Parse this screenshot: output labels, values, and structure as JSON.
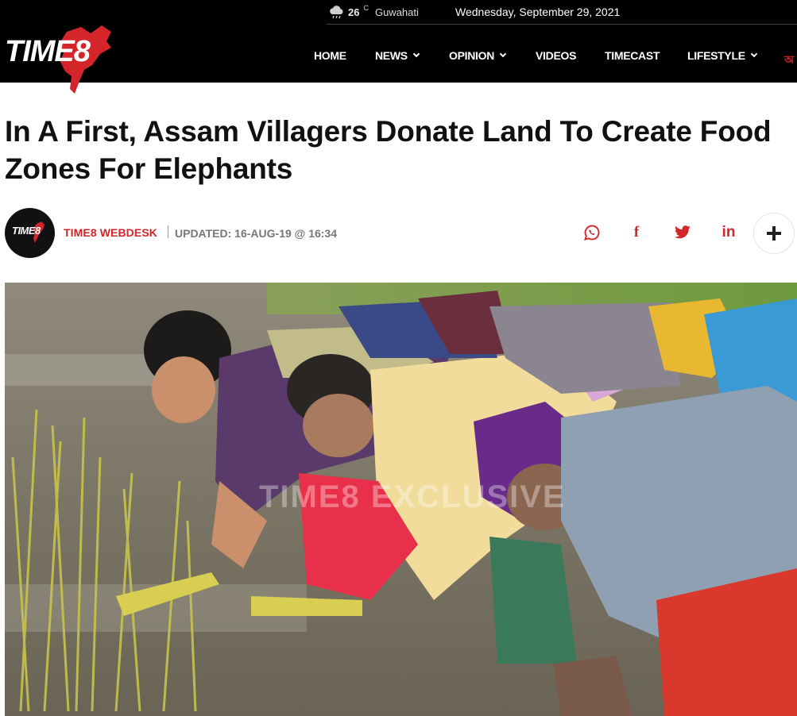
{
  "topbar": {
    "weather_temp": "26",
    "weather_unit": "C",
    "weather_city": "Guwahati",
    "weather_icon": "cloud-rain-icon",
    "date": "Wednesday, September 29, 2021"
  },
  "logo": {
    "text": "TIME8"
  },
  "nav": {
    "items": [
      {
        "label": "HOME",
        "dropdown": false
      },
      {
        "label": "NEWS",
        "dropdown": true
      },
      {
        "label": "OPINION",
        "dropdown": true
      },
      {
        "label": "VIDEOS",
        "dropdown": false
      },
      {
        "label": "TIMECAST",
        "dropdown": false
      },
      {
        "label": "LIFESTYLE",
        "dropdown": true
      }
    ],
    "edge_glyph": "অ"
  },
  "article": {
    "title": "In A First, Assam Villagers Donate Land To Create Food Zones For Elephants",
    "author": "TIME8 WEBDESK",
    "updated": "UPDATED: 16-AUG-19 @ 16:34",
    "avatar_text": "TIME8",
    "image_watermark": "TIME8   EXCLUSIVE"
  },
  "share": {
    "whatsapp_icon": "whatsapp-icon",
    "facebook_glyph": "f",
    "twitter_icon": "twitter-icon",
    "linkedin_glyph": "in",
    "more_icon": "plus-icon"
  },
  "colors": {
    "brand_red": "#d4252b",
    "header_bg": "#000000",
    "meta_gray": "#777777"
  }
}
